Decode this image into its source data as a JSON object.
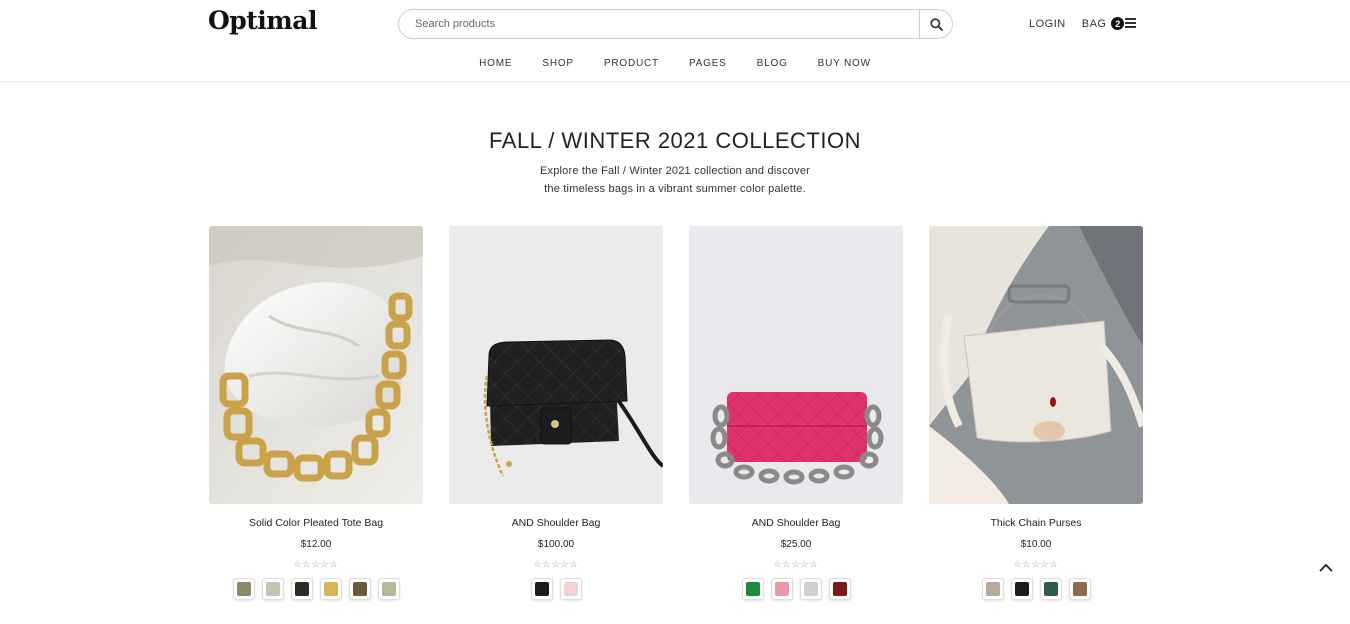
{
  "header": {
    "logo": "Optimal",
    "search_placeholder": "Search products",
    "login": "LOGIN",
    "bag": "BAG",
    "bag_count": "2"
  },
  "nav": [
    "HOME",
    "SHOP",
    "PRODUCT",
    "PAGES",
    "BLOG",
    "BUY NOW"
  ],
  "section": {
    "title": "FALL / WINTER 2021 COLLECTION",
    "subtitle_line1": "Explore the Fall / Winter 2021 collection and discover",
    "subtitle_line2": "the timeless bags in a vibrant summer color palette."
  },
  "products": [
    {
      "name": "Solid Color Pleated Tote Bag",
      "price": "$12.00",
      "rating": 0,
      "swatches": [
        "#8a8a6a",
        "#c8c2b0",
        "#2b2b22",
        "#d8b55a",
        "#6b5a3a",
        "#b8b89a"
      ]
    },
    {
      "name": "AND Shoulder Bag",
      "price": "$100.00",
      "rating": 0,
      "swatches": [
        "#1c1c1c",
        "#f1d3d3"
      ]
    },
    {
      "name": "AND Shoulder Bag",
      "price": "$25.00",
      "rating": 0,
      "swatches": [
        "#1f8a3c",
        "#e79aa8",
        "#cfcfcf",
        "#7a1a1a"
      ]
    },
    {
      "name": "Thick Chain Purses",
      "price": "$10.00",
      "rating": 0,
      "swatches": [
        "#b9aa98",
        "#1b1b1b",
        "#2f5b4a",
        "#8a6a4a"
      ]
    }
  ],
  "stars_glyph": "☆☆☆☆☆",
  "icons": {
    "search": "search-icon",
    "menu": "menu-icon",
    "back_to_top": "chevron-up-icon"
  }
}
